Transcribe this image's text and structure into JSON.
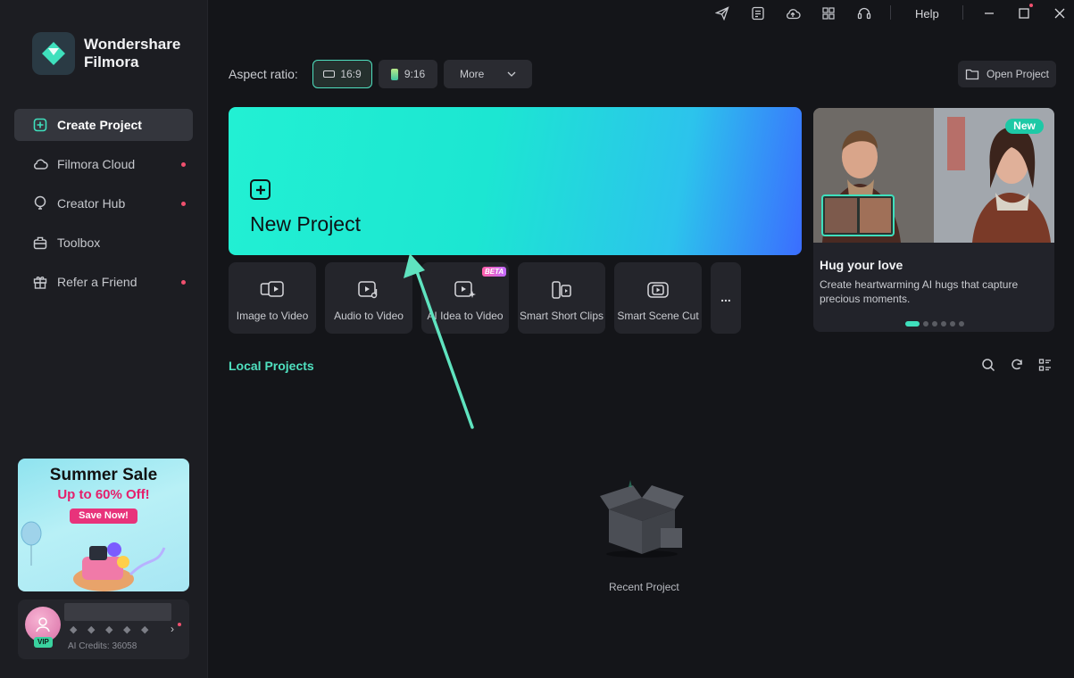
{
  "brand": {
    "name": "Wondershare Filmora",
    "line1": "Wondershare",
    "line2": "Filmora"
  },
  "sidebar": {
    "items": [
      {
        "label": "Create Project",
        "icon": "plus-square-icon",
        "active": true,
        "dot": false
      },
      {
        "label": "Filmora Cloud",
        "icon": "cloud-icon",
        "active": false,
        "dot": true
      },
      {
        "label": "Creator Hub",
        "icon": "bulb-icon",
        "active": false,
        "dot": true
      },
      {
        "label": "Toolbox",
        "icon": "toolbox-icon",
        "active": false,
        "dot": false
      },
      {
        "label": "Refer a Friend",
        "icon": "gift-icon",
        "active": false,
        "dot": true
      }
    ]
  },
  "promo": {
    "title": "Summer Sale",
    "subtitle": "Up to 60% Off!",
    "button": "Save Now!"
  },
  "user": {
    "badge": "VIP",
    "credits": "AI Credits: 36058"
  },
  "titlebar": {
    "icons": [
      "send-icon",
      "task-list-icon",
      "cloud-upload-icon",
      "apps-grid-icon",
      "headset-icon"
    ],
    "help": "Help"
  },
  "aspect": {
    "label": "Aspect ratio:",
    "options": [
      "16:9",
      "9:16"
    ],
    "selected": "16:9",
    "more": "More"
  },
  "open_project": "Open Project",
  "new_project": {
    "label": "New Project"
  },
  "tools": [
    {
      "label": "Image to Video",
      "icon": "image-to-video-icon"
    },
    {
      "label": "Audio to Video",
      "icon": "audio-to-video-icon"
    },
    {
      "label": "AI Idea to Video",
      "icon": "ai-idea-video-icon",
      "badge": "BETA"
    },
    {
      "label": "Smart Short Clips",
      "icon": "short-clips-icon"
    },
    {
      "label": "Smart Scene Cut",
      "icon": "scene-cut-icon"
    }
  ],
  "more_tools": "...",
  "feature": {
    "badge": "New",
    "title": "Hug your love",
    "description": "Create heartwarming AI hugs that capture precious moments.",
    "slides": 6,
    "active_slide": 1
  },
  "local_projects": {
    "title": "Local Projects",
    "empty_label": "Recent Project"
  },
  "colors": {
    "accent": "#4fe0bf",
    "new_badge": "#1ec9a6",
    "notify_dot": "#f0506e"
  }
}
